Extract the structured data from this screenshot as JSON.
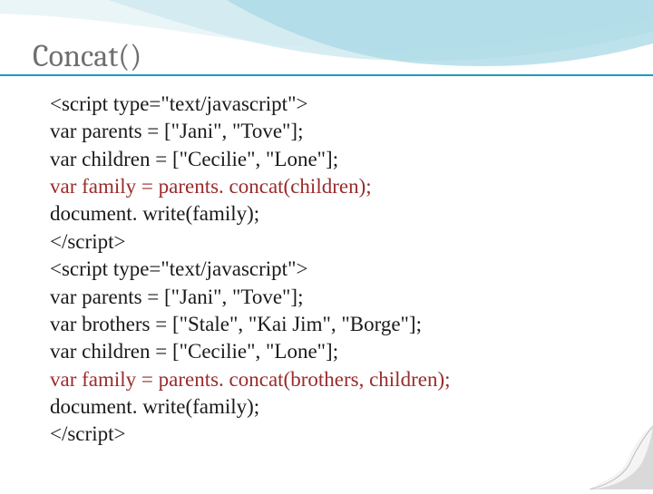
{
  "title": "Concat()",
  "code": {
    "l1": "<script type=\"text/javascript\">",
    "l2": "var parents = [\"Jani\", \"Tove\"];",
    "l3": "var children = [\"Cecilie\", \"Lone\"];",
    "l4": "var family = parents. concat(children);",
    "l5": "document. write(family);",
    "l6": "</scr",
    "l6b": "ipt>",
    "l7": "<script type=\"text/javascript\">",
    "l8": "var parents = [\"Jani\", \"Tove\"];",
    "l9": "var brothers = [\"Stale\", \"Kai Jim\", \"Borge\"];",
    "l10": "var children = [\"Cecilie\", \"Lone\"];",
    "l11": "var family = parents. concat(brothers, children);",
    "l12": "document. write(family);",
    "l13": "</scr",
    "l13b": "ipt>"
  }
}
